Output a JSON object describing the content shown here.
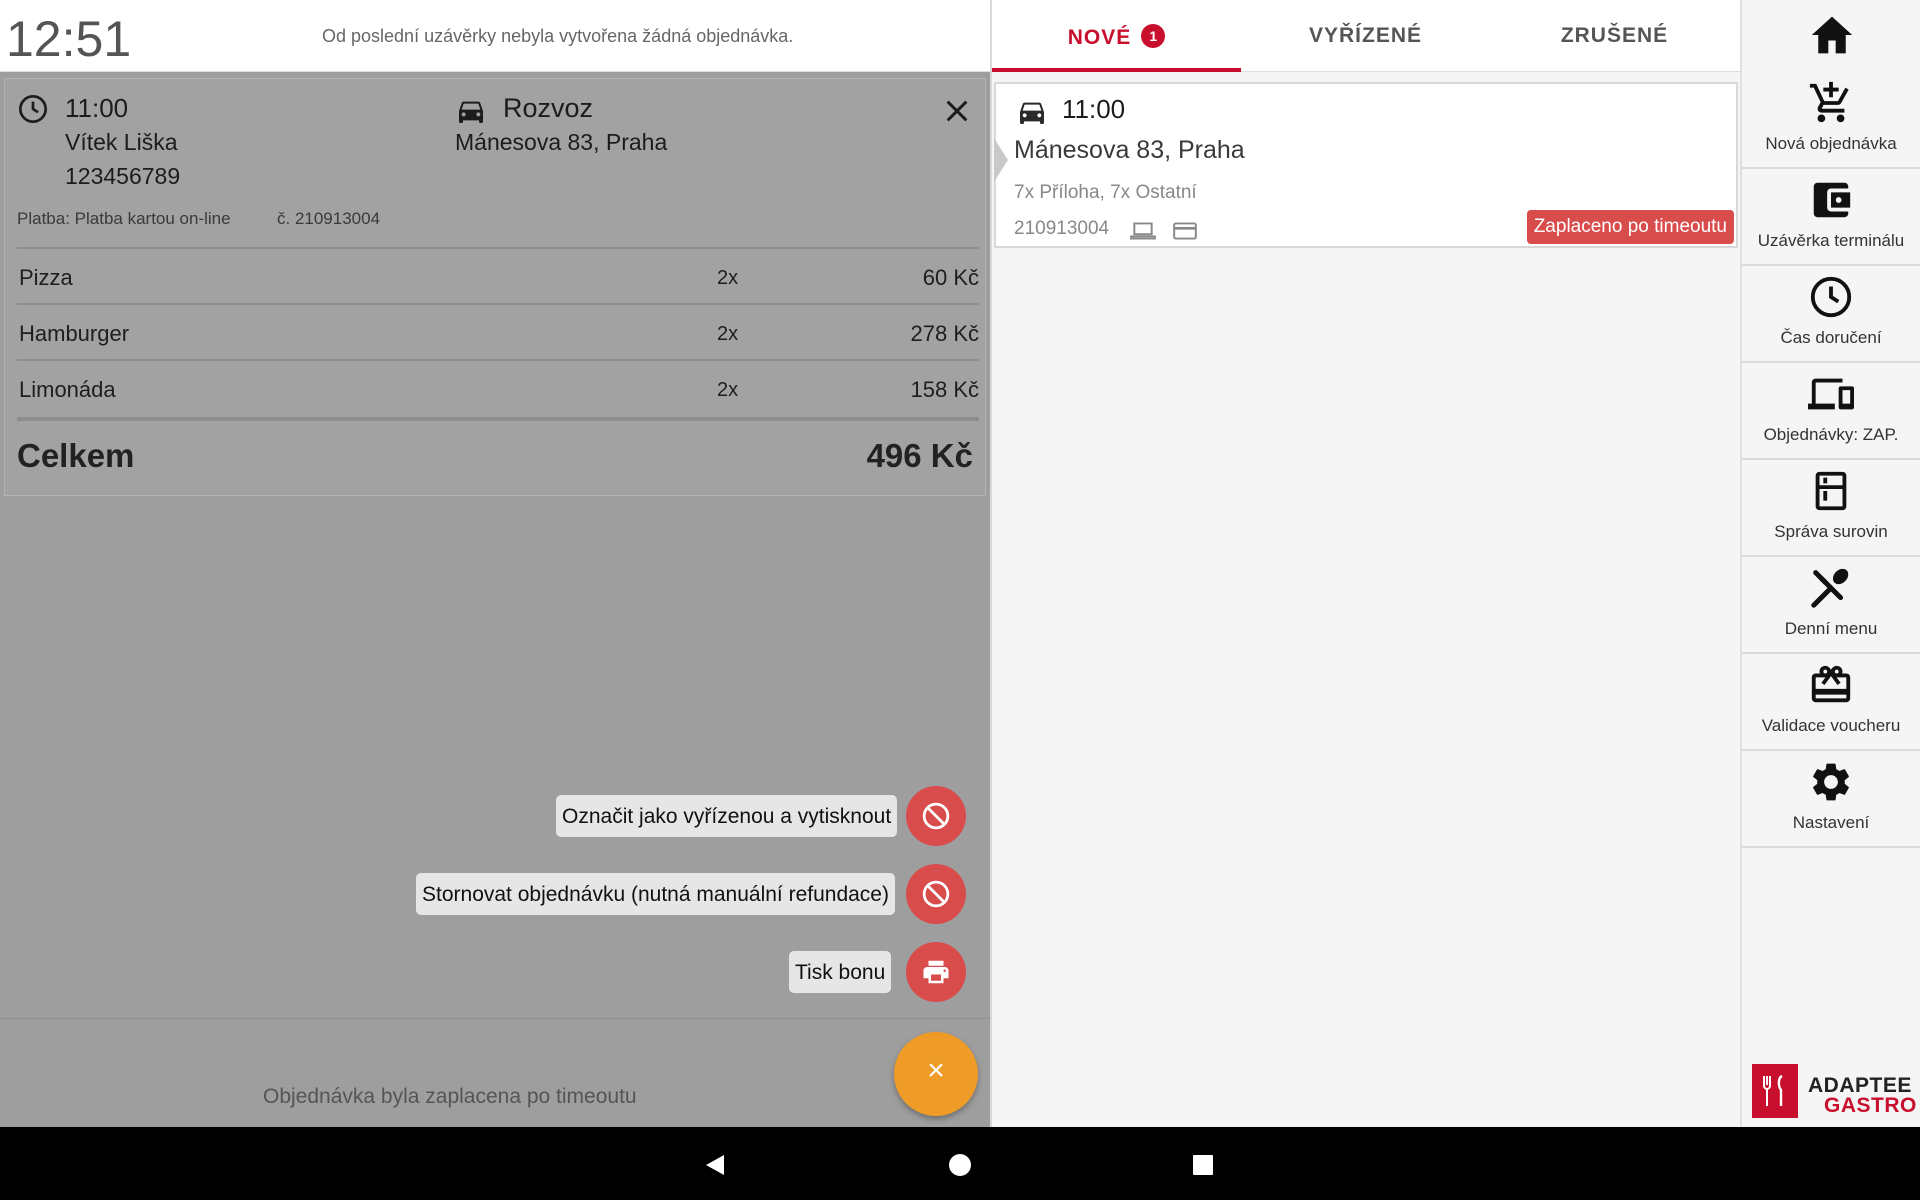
{
  "status_bar": {
    "time": "12:51"
  },
  "left_header": {
    "info": "Od poslední uzávěrky nebyla vytvořena žádná objednávka."
  },
  "order_detail": {
    "time": "11:00",
    "customer_name": "Vítek Liška",
    "phone": "123456789",
    "delivery_type": "Rozvoz",
    "address": "Mánesova 83, Praha",
    "payment": "Platba: Platba kartou on-line",
    "number": "č. 210913004",
    "items": [
      {
        "name": "Pizza",
        "qty": "2x",
        "price": "60 Kč"
      },
      {
        "name": "Hamburger",
        "qty": "2x",
        "price": "278 Kč"
      },
      {
        "name": "Limonáda",
        "qty": "2x",
        "price": "158 Kč"
      }
    ],
    "total_label": "Celkem",
    "total_value": "496 Kč"
  },
  "actions": [
    {
      "label": "Označit jako vyřízenou a vytisknout",
      "icon": "block-icon"
    },
    {
      "label": "Stornovat objednávku (nutná manuální refundace)",
      "icon": "block-icon"
    },
    {
      "label": "Tisk bonu",
      "icon": "print-icon"
    }
  ],
  "footer": {
    "message": "Objednávka byla zaplacena po timeoutu",
    "fab_label": "×"
  },
  "tabs": [
    {
      "label": "NOVÉ",
      "badge": "1",
      "active": true
    },
    {
      "label": "VYŘÍZENÉ"
    },
    {
      "label": "ZRUŠENÉ"
    }
  ],
  "order_card": {
    "time": "11:00",
    "address": "Mánesova 83, Praha",
    "items": "7x Příloha, 7x Ostatní",
    "number": "210913004",
    "status": "Zaplaceno po timeoutu"
  },
  "sidebar": {
    "items": [
      {
        "label": "Nová objednávka",
        "icon": "add-cart-icon"
      },
      {
        "label": "Uzávěrka terminálu",
        "icon": "wallet-icon"
      },
      {
        "label": "Čas doručení",
        "icon": "clock-icon"
      },
      {
        "label": "Objednávky: ZAP.",
        "icon": "devices-icon"
      },
      {
        "label": "Správa surovin",
        "icon": "fridge-icon"
      },
      {
        "label": "Denní menu",
        "icon": "utensils-icon"
      },
      {
        "label": "Validace voucheru",
        "icon": "gift-card-icon"
      },
      {
        "label": "Nastavení",
        "icon": "gear-icon"
      }
    ]
  },
  "logo": {
    "line1": "ADAPTEE",
    "line2": "GASTRO"
  },
  "colors": {
    "accent": "#c8102e",
    "action_red": "#d94c4c",
    "fab_orange": "#ef9b27"
  }
}
